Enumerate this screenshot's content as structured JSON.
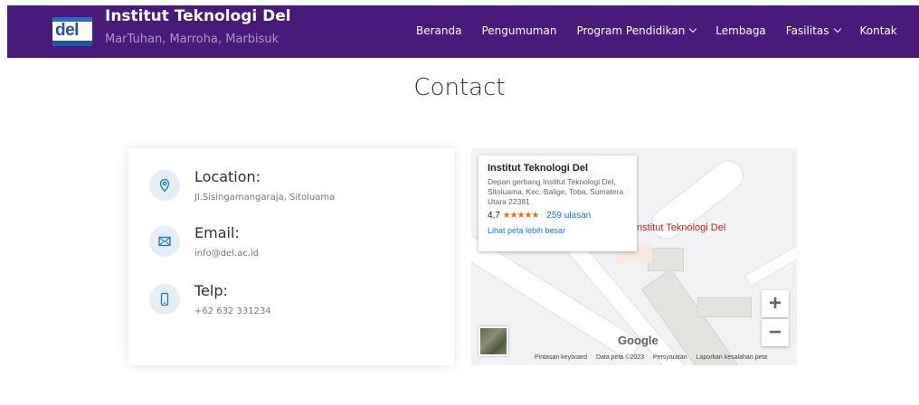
{
  "header": {
    "logo_text": "del",
    "title": "Institut Teknologi Del",
    "subtitle": "MarTuhan, Marroha, Marbisuk",
    "nav": [
      {
        "label": "Beranda",
        "dropdown": false
      },
      {
        "label": "Pengumuman",
        "dropdown": false
      },
      {
        "label": "Program Pendidikan",
        "dropdown": true
      },
      {
        "label": "Lembaga",
        "dropdown": false
      },
      {
        "label": "Fasilitas",
        "dropdown": true
      },
      {
        "label": "Kontak",
        "dropdown": false
      }
    ],
    "colors": {
      "bar": "#4a1a7a",
      "subtitle": "#a89bc3"
    }
  },
  "page": {
    "title": "Contact"
  },
  "contact": {
    "location": {
      "label": "Location:",
      "value": "Jl.Sisingamangaraja, Sitoluama",
      "icon": "map-pin-icon"
    },
    "email": {
      "label": "Email:",
      "value": "info@del.ac.id",
      "icon": "envelope-icon"
    },
    "phone": {
      "label": "Telp:",
      "value": "+62 632 331234",
      "icon": "phone-icon"
    },
    "icon_color": "#1b75bb"
  },
  "map": {
    "place_label": "Institut Teknologi Del",
    "card": {
      "title": "Institut Teknologi Del",
      "address": "Depan gerbang Institut Teknologi Del, Sitoluama, Kec. Balige, Toba, Sumatera Utara 22381",
      "rating": "4,7",
      "stars": "★★★★★",
      "reviews": "259 ulasan",
      "link": "Lihat peta lebih besar"
    },
    "zoom_in": "+",
    "zoom_out": "−",
    "logo": "Google",
    "attribution": [
      "Pintasan keyboard",
      "Data peta ©2023",
      "Persyaratan",
      "Laporkan kesalahan peta"
    ]
  }
}
